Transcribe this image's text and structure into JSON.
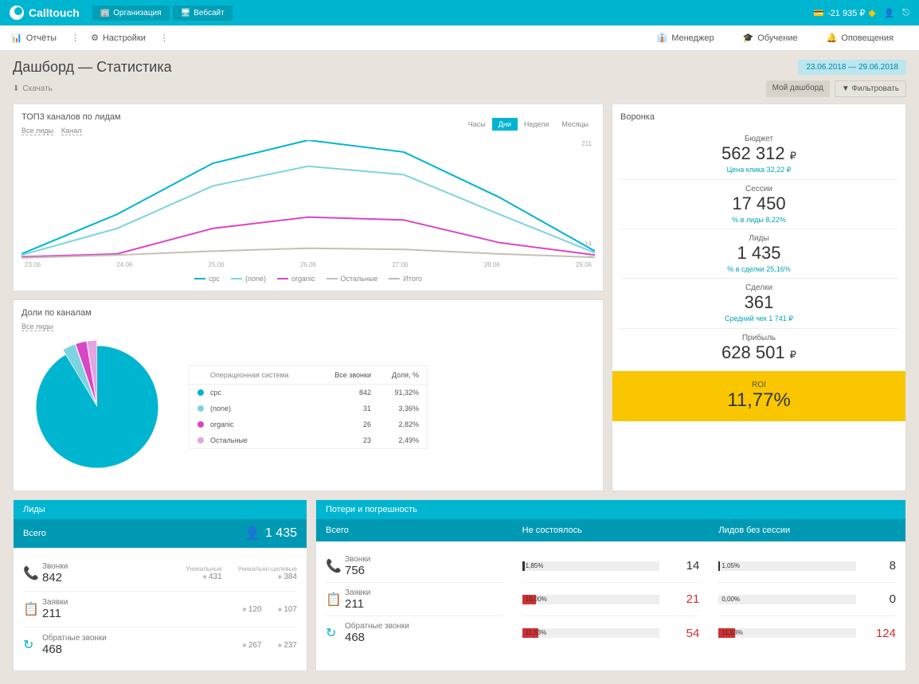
{
  "brand": "Calltouch",
  "breadcrumb": {
    "org": "Организация",
    "site": "Вебсайт"
  },
  "balance": "-21 935 ₽",
  "subnav": {
    "reports": "Отчёты",
    "settings": "Настройки",
    "manager": "Менеджер",
    "training": "Обучение",
    "alerts": "Оповещения"
  },
  "page_title": "Дашборд — Статистика",
  "date_range": "23.06.2018 — 29.06.2018",
  "download": "Скачать",
  "my_dashboard": "Мой дашборд",
  "filter": "Фильтровать",
  "top3": {
    "title": "ТОП3 каналов по лидам",
    "filter1": "Все лиды",
    "filter2": "Канал",
    "tabs": [
      "Часы",
      "Дни",
      "Недели",
      "Месяцы"
    ],
    "active_tab": 1,
    "y_max": "211",
    "y_mid": "14",
    "y_min": "0",
    "x_labels": [
      "23.06",
      "24.06",
      "25.06",
      "26.06",
      "27.06",
      "28.06",
      "29.06"
    ],
    "legend": [
      {
        "name": "cpc",
        "color": "#00b5d0"
      },
      {
        "name": "(none)",
        "color": "#7dd3e0"
      },
      {
        "name": "organic",
        "color": "#d945c7"
      },
      {
        "name": "Остальные",
        "color": "#c5c0b6"
      },
      {
        "name": "Итого",
        "color": "#bbb"
      }
    ]
  },
  "shares": {
    "title": "Доли по каналам",
    "filter": "Все лиды",
    "table_headers": {
      "os": "Операционная система",
      "calls": "Все звонки",
      "pct": "Доля, %"
    },
    "rows": [
      {
        "name": "cpc",
        "calls": "842",
        "pct": "91,32%",
        "color": "#00b5d0"
      },
      {
        "name": "(none)",
        "calls": "31",
        "pct": "3,36%",
        "color": "#7dd3e0"
      },
      {
        "name": "organic",
        "calls": "26",
        "pct": "2,82%",
        "color": "#d945c7"
      },
      {
        "name": "Остальные",
        "calls": "23",
        "pct": "2,49%",
        "color": "#e5a4e0"
      }
    ]
  },
  "funnel": {
    "title": "Воронка",
    "steps": [
      {
        "label": "Бюджет",
        "value": "562 312",
        "unit": "₽",
        "sub": "Цена клика  32,22 ₽"
      },
      {
        "label": "Сессии",
        "value": "17 450",
        "unit": "",
        "sub": "% в лиды  8,22%"
      },
      {
        "label": "Лиды",
        "value": "1 435",
        "unit": "",
        "sub": "% в сделки  25,16%"
      },
      {
        "label": "Сделки",
        "value": "361",
        "unit": "",
        "sub": "Средний чек  1 741 ₽"
      },
      {
        "label": "Прибыль",
        "value": "628 501",
        "unit": "₽",
        "sub": ""
      }
    ],
    "roi_label": "ROI",
    "roi_value": "11,77%"
  },
  "leads": {
    "title": "Лиды",
    "total_label": "Всего",
    "total": "1 435",
    "col_unique": "Уникальные",
    "col_unique_target": "Уникально-целевые",
    "rows": [
      {
        "icon": "phone",
        "label": "Звонки",
        "value": "842",
        "unique": "431",
        "target": "384"
      },
      {
        "icon": "form",
        "label": "Заявки",
        "value": "211",
        "unique": "120",
        "target": "107"
      },
      {
        "icon": "callback",
        "label": "Обратные звонки",
        "value": "468",
        "unique": "267",
        "target": "237"
      }
    ]
  },
  "loss": {
    "title": "Потери и погрешность",
    "col1": "Всего",
    "col2": "Не состоялось",
    "col3": "Лидов без сессии",
    "rows": [
      {
        "icon": "phone",
        "label": "Звонки",
        "total": "756",
        "miss_pct": "1,85%",
        "miss_bar": 2,
        "miss_val": "14",
        "nosess_pct": "1,05%",
        "nosess_bar": 1,
        "nosess_val": "8",
        "miss_dark": true,
        "nosess_dark": true
      },
      {
        "icon": "form",
        "label": "Заявки",
        "total": "211",
        "miss_pct": "10,00%",
        "miss_bar": 10,
        "miss_val": "21",
        "nosess_pct": "0,00%",
        "nosess_bar": 0,
        "nosess_val": "0",
        "miss_red": true
      },
      {
        "icon": "callback",
        "label": "Обратные звонки",
        "total": "468",
        "miss_pct": "11,53%",
        "miss_bar": 12,
        "miss_val": "54",
        "nosess_pct": "11,53%",
        "nosess_bar": 12,
        "nosess_val": "124",
        "miss_red": true,
        "nosess_red": true
      }
    ]
  },
  "chart_data": {
    "type": "line",
    "categories": [
      "23.06",
      "24.06",
      "25.06",
      "26.06",
      "27.06",
      "28.06",
      "29.06"
    ],
    "series": [
      {
        "name": "cpc",
        "color": "#00b5d0",
        "values": [
          10,
          80,
          170,
          211,
          190,
          110,
          15
        ]
      },
      {
        "name": "(none)",
        "color": "#7dd3e0",
        "values": [
          8,
          55,
          130,
          165,
          150,
          80,
          12
        ]
      },
      {
        "name": "organic",
        "color": "#d945c7",
        "values": [
          5,
          10,
          55,
          75,
          70,
          30,
          8
        ]
      },
      {
        "name": "Остальные",
        "color": "#c5c0b6",
        "values": [
          3,
          8,
          15,
          20,
          18,
          10,
          4
        ]
      }
    ],
    "ylim": [
      0,
      211
    ]
  }
}
